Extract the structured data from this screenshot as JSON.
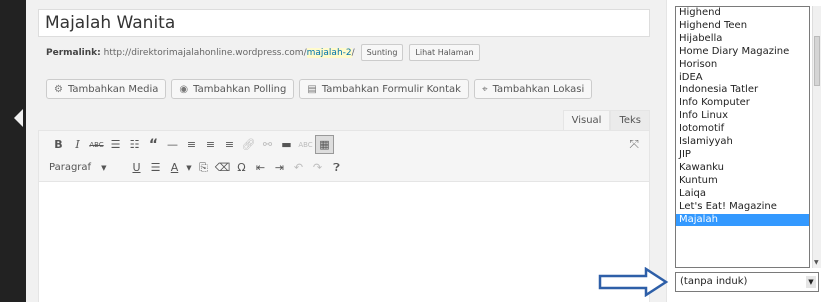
{
  "post": {
    "title": "Majalah Wanita",
    "permalink_label": "Permalink:",
    "permalink_base": "http://direktorimajalahonline.wordpress.com/",
    "permalink_slug": "majalah-2",
    "permalink_end": "/",
    "edit_label": "Sunting",
    "view_label": "Lihat Halaman"
  },
  "media_buttons": [
    {
      "icon": "media-icon",
      "glyph": "⚙",
      "label": "Tambahkan Media"
    },
    {
      "icon": "poll-icon",
      "glyph": "◉",
      "label": "Tambahkan Polling"
    },
    {
      "icon": "form-icon",
      "glyph": "▤",
      "label": "Tambahkan Formulir Kontak"
    },
    {
      "icon": "location-icon",
      "glyph": "⌖",
      "label": "Tambahkan Lokasi"
    }
  ],
  "editor_tabs": {
    "visual": "Visual",
    "text": "Teks"
  },
  "toolbar": {
    "paragraph_label": "Paragraf"
  },
  "category_dropdown": {
    "items": [
      "Highend",
      "Highend Teen",
      "Hijabella",
      "Home Diary Magazine",
      "Horison",
      "iDEA",
      "Indonesia Tatler",
      "Info Komputer",
      "Info Linux",
      "Iotomotif",
      "Islamiyyah",
      "JIP",
      "Kawanku",
      "Kuntum",
      "Laiqa",
      "Let's Eat! Magazine",
      "Majalah"
    ],
    "selected": "Majalah",
    "parent_value": "(tanpa induk)"
  },
  "colors": {
    "sidebar": "#222222",
    "selection": "#3399ff",
    "arrow": "#2e5fa8"
  }
}
